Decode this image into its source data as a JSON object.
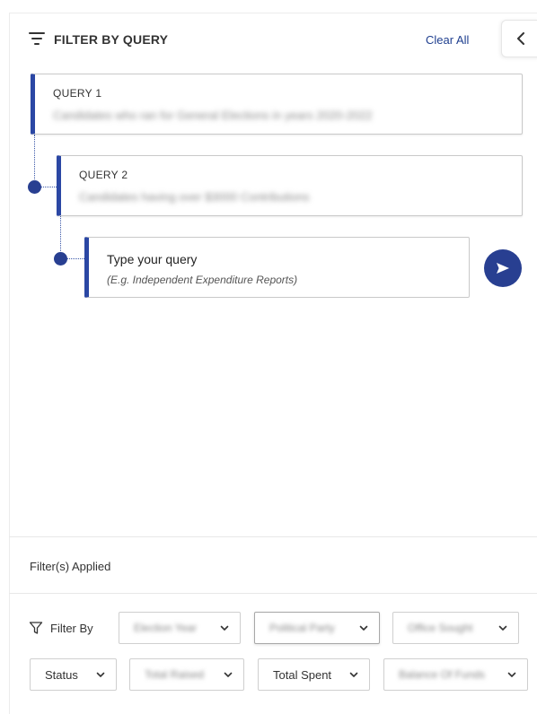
{
  "header": {
    "title": "FILTER BY QUERY",
    "clear_all": "Clear All"
  },
  "queries": [
    {
      "label": "QUERY 1",
      "text": "Candidates who ran for General Elections in years 2020-2022"
    },
    {
      "label": "QUERY 2",
      "text": "Candidates having over $3000 Contributions"
    }
  ],
  "input": {
    "placeholder": "Type your query",
    "hint": "(E.g. Independent Expenditure Reports)"
  },
  "filters_applied": {
    "label": "Filter(s) Applied"
  },
  "filter_bar": {
    "label": "Filter By",
    "dropdowns": [
      {
        "label": "Election Year"
      },
      {
        "label": "Political Party"
      },
      {
        "label": "Office Sought"
      },
      {
        "label": "Status"
      },
      {
        "label": "Total Raised"
      },
      {
        "label": "Total Spent"
      },
      {
        "label": "Balance Of Funds"
      }
    ]
  },
  "colors": {
    "accent": "#283f91",
    "card_border_accent": "#2b47a4",
    "link": "#1f3f8f"
  }
}
